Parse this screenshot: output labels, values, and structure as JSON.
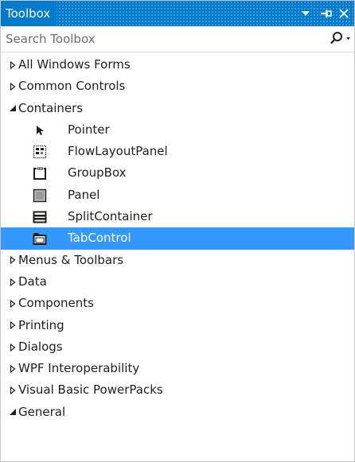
{
  "window": {
    "title": "Toolbox"
  },
  "search": {
    "placeholder": "Search Toolbox",
    "value": ""
  },
  "tree": {
    "categories_before": [
      {
        "label": "All Windows Forms",
        "expanded": false
      },
      {
        "label": "Common Controls",
        "expanded": false
      }
    ],
    "containers": {
      "label": "Containers",
      "expanded": true,
      "items": [
        {
          "label": "Pointer",
          "icon": "pointer-icon",
          "selected": false
        },
        {
          "label": "FlowLayoutPanel",
          "icon": "flowlayoutpanel-icon",
          "selected": false
        },
        {
          "label": "GroupBox",
          "icon": "groupbox-icon",
          "selected": false
        },
        {
          "label": "Panel",
          "icon": "panel-icon",
          "selected": false
        },
        {
          "label": "SplitContainer",
          "icon": "splitcontainer-icon",
          "selected": false
        },
        {
          "label": "TabControl",
          "icon": "tabcontrol-icon",
          "selected": true
        }
      ]
    },
    "categories_after": [
      {
        "label": "Menus & Toolbars",
        "expanded": false
      },
      {
        "label": "Data",
        "expanded": false
      },
      {
        "label": "Components",
        "expanded": false
      },
      {
        "label": "Printing",
        "expanded": false
      },
      {
        "label": "Dialogs",
        "expanded": false
      },
      {
        "label": "WPF Interoperability",
        "expanded": false
      },
      {
        "label": "Visual Basic PowerPacks",
        "expanded": false
      },
      {
        "label": "General",
        "expanded": true
      }
    ]
  },
  "colors": {
    "titlebar": "#007acc",
    "selection": "#3399ff",
    "text": "#1e1e1e",
    "placeholder": "#6d6d6d"
  }
}
